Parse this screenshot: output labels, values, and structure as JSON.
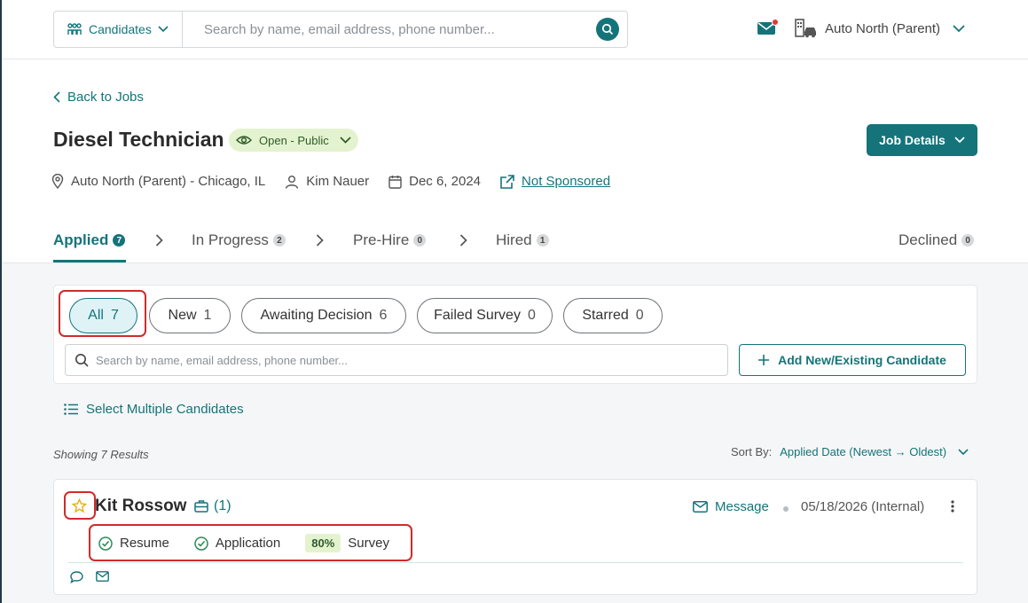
{
  "topbar": {
    "scope_label": "Candidates",
    "search_placeholder": "Search by name, email address, phone number...",
    "account_name": "Auto North (Parent)"
  },
  "job": {
    "back_label": "Back to Jobs",
    "title": "Diesel Technician",
    "status": "Open - Public",
    "details_button": "Job Details",
    "location": "Auto North (Parent) - Chicago, IL",
    "recruiter": "Kim Nauer",
    "date": "Dec 6, 2024",
    "sponsor_link": "Not Sponsored"
  },
  "stages": [
    {
      "label": "Applied",
      "count": "7"
    },
    {
      "label": "In Progress",
      "count": "2"
    },
    {
      "label": "Pre-Hire",
      "count": "0"
    },
    {
      "label": "Hired",
      "count": "1"
    },
    {
      "label": "Declined",
      "count": "0"
    }
  ],
  "filters": [
    {
      "label": "All",
      "count": "7"
    },
    {
      "label": "New",
      "count": "1"
    },
    {
      "label": "Awaiting Decision",
      "count": "6"
    },
    {
      "label": "Failed Survey",
      "count": "0"
    },
    {
      "label": "Starred",
      "count": "0"
    }
  ],
  "list": {
    "search_placeholder": "Search by name, email address, phone number...",
    "add_button": "Add New/Existing Candidate",
    "select_multiple": "Select Multiple Candidates",
    "results_text": "Showing 7 Results",
    "sort_label": "Sort By:",
    "sort_value": "Applied Date (Newest → Oldest)"
  },
  "candidate": {
    "name": "Kit Rossow",
    "jobs_count": "(1)",
    "message_label": "Message",
    "applied": "05/18/2026 (Internal)",
    "resume_label": "Resume",
    "application_label": "Application",
    "survey_score": "80%",
    "survey_label": "Survey"
  },
  "colors": {
    "accent": "#14747a",
    "highlight": "#cf2b2b",
    "status_bg": "#e4f3cf"
  }
}
